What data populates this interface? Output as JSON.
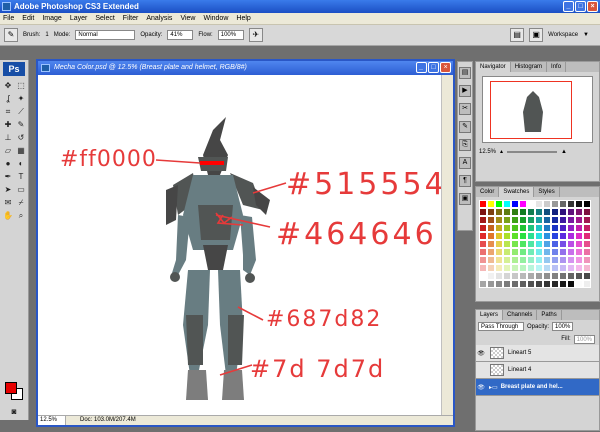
{
  "app": {
    "title": "Adobe Photoshop CS3 Extended"
  },
  "menu": [
    "File",
    "Edit",
    "Image",
    "Layer",
    "Select",
    "Filter",
    "Analysis",
    "View",
    "Window",
    "Help"
  ],
  "options": {
    "brush_label": "Brush:",
    "brush_size": "1",
    "mode_label": "Mode:",
    "mode_value": "Normal",
    "opacity_label": "Opacity:",
    "opacity_value": "41%",
    "flow_label": "Flow:",
    "flow_value": "100%",
    "workspace_label": "Workspace"
  },
  "document": {
    "title": "Mecha Color.psd @ 12.5% (Breast plate and helmet, RGB/8#)",
    "zoom": "12.5%",
    "doc_info": "Doc: 103.0M/207.4M",
    "annotations": [
      "#ff0000",
      "#515554",
      "#464646",
      "#687d82",
      "#7d 7d7d"
    ]
  },
  "colors": {
    "foreground": "#e60000",
    "background": "#ffffff",
    "annotation": "#e63a3a",
    "mech_light": "#687d82",
    "mech_dark": "#515554",
    "mech_darker": "#464646",
    "visor": "#ff0000"
  },
  "navigator": {
    "tabs": [
      "Navigator",
      "Histogram",
      "Info"
    ],
    "zoom": "12.5%"
  },
  "swatches": {
    "tabs": [
      "Color",
      "Swatches",
      "Styles"
    ]
  },
  "layers": {
    "tabs": [
      "Layers",
      "Channels",
      "Paths"
    ],
    "blend_mode": "Pass Through",
    "opacity_label": "Opacity:",
    "opacity_value": "100%",
    "fill_label": "Fill:",
    "fill_value": "100%",
    "items": [
      "Lineart 5",
      "Lineart 4",
      "Breast plate and hel..."
    ]
  }
}
